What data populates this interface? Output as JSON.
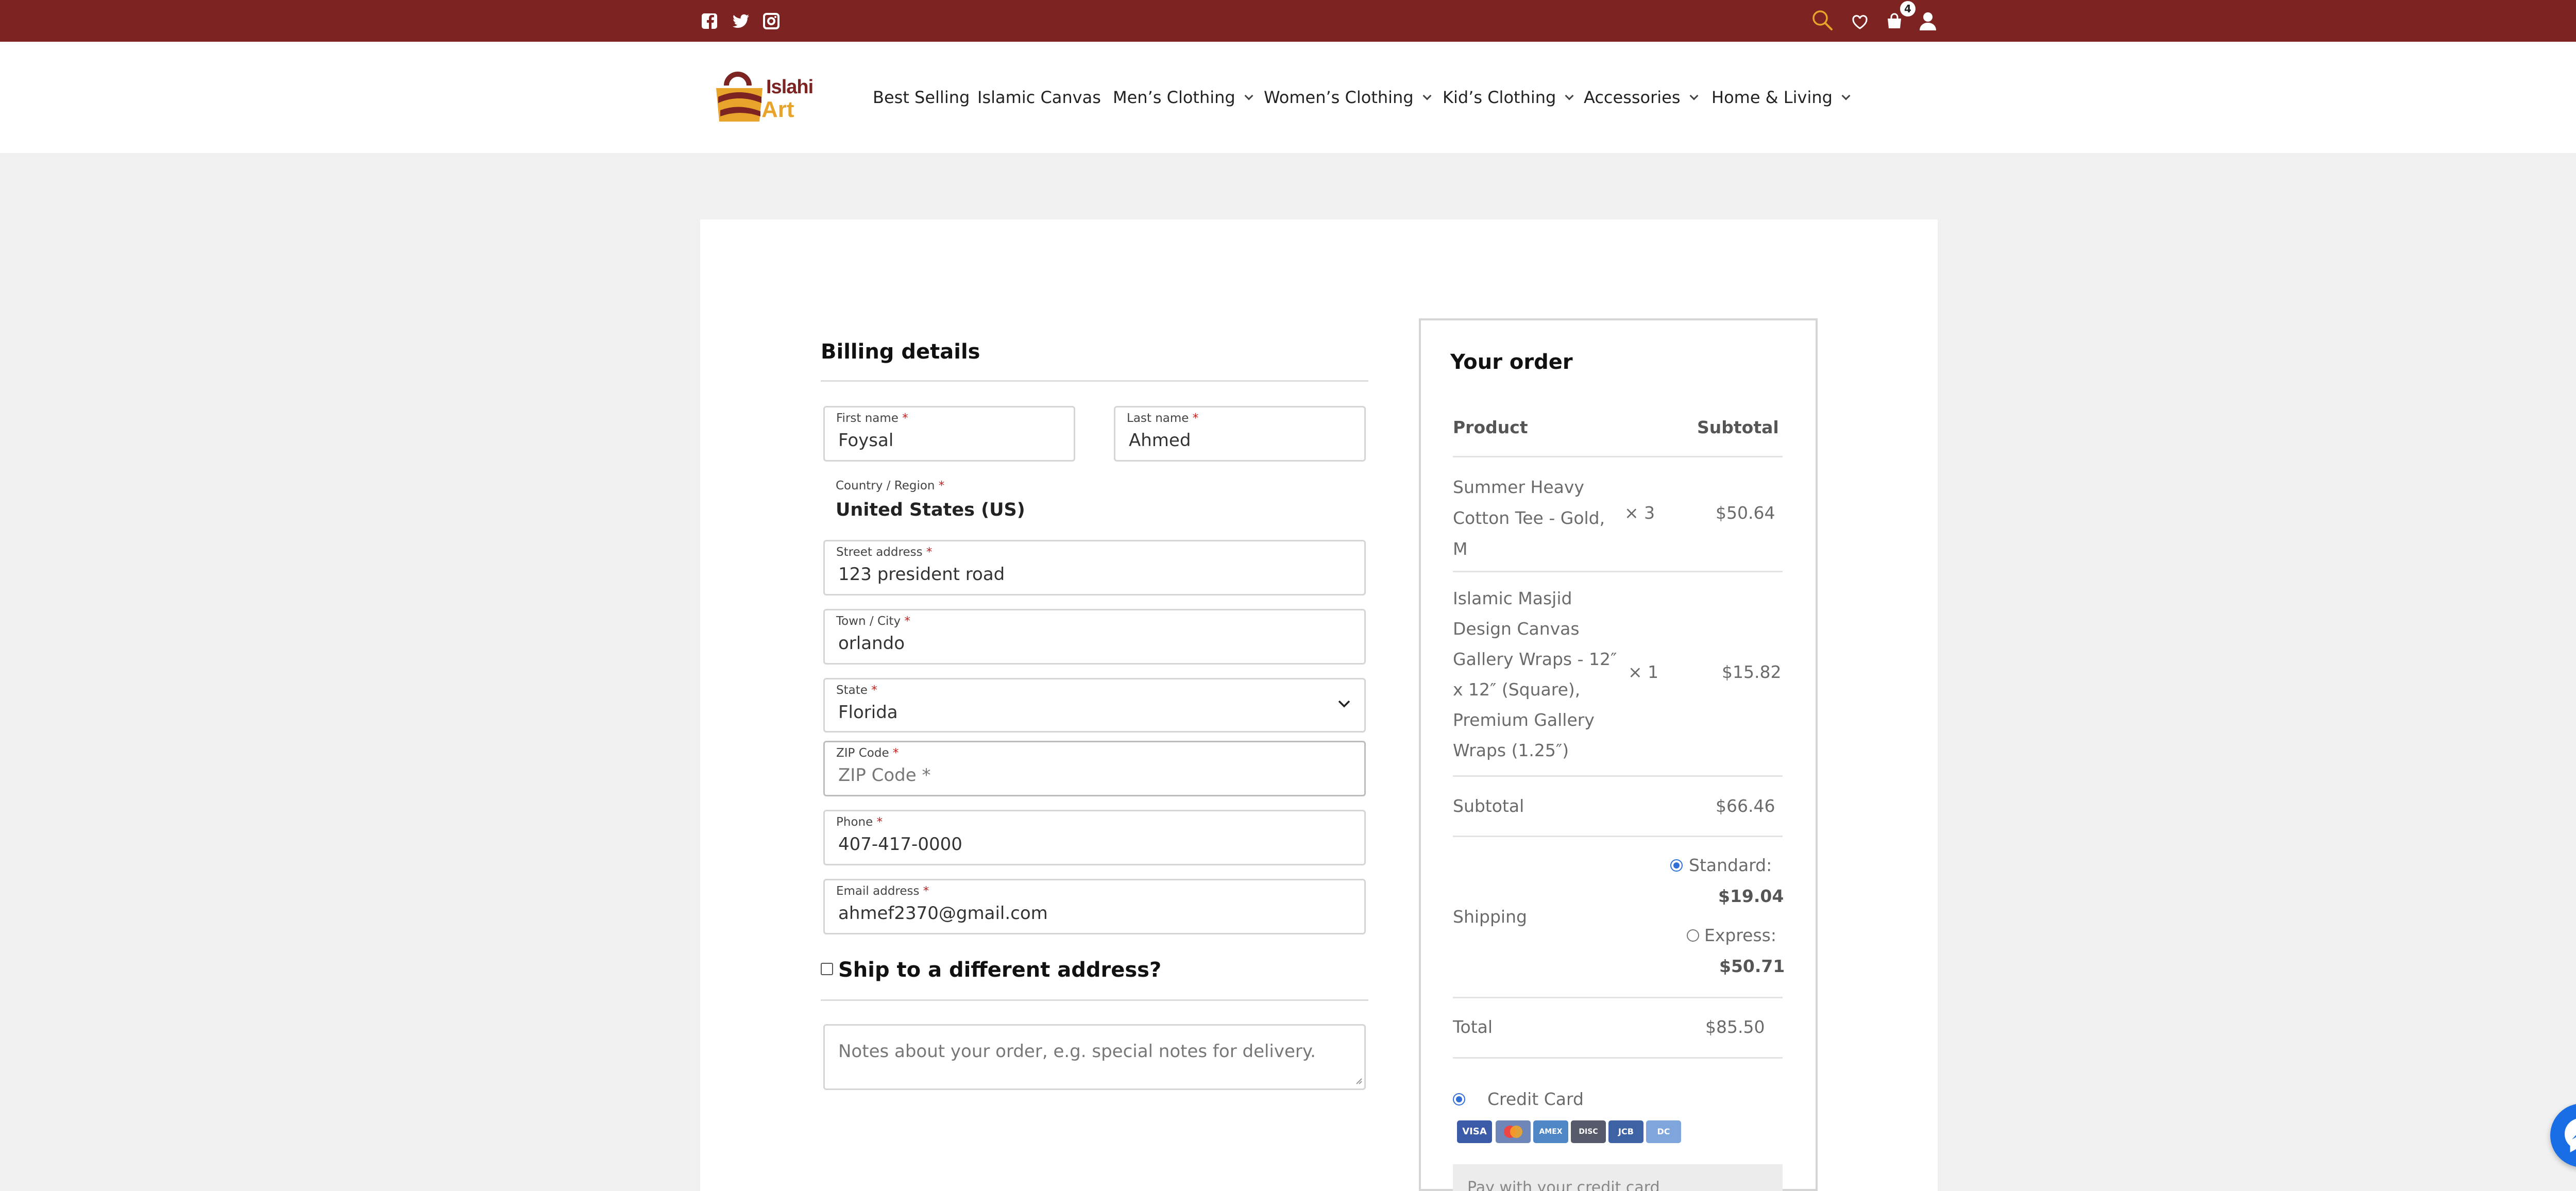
{
  "topbar": {
    "social": [
      "facebook-icon",
      "twitter-icon",
      "instagram-icon"
    ],
    "cart_count": "4"
  },
  "brand": {
    "line1": "Islahi",
    "line2": "Art"
  },
  "nav": [
    {
      "label": "Best Selling",
      "has_menu": false
    },
    {
      "label": "Islamic Canvas",
      "has_menu": false
    },
    {
      "label": "Men’s Clothing",
      "has_menu": true
    },
    {
      "label": "Women’s Clothing",
      "has_menu": true
    },
    {
      "label": "Kid’s Clothing",
      "has_menu": true
    },
    {
      "label": "Accessories",
      "has_menu": true
    },
    {
      "label": "Home & Living",
      "has_menu": true
    }
  ],
  "billing": {
    "title": "Billing details",
    "first_name": {
      "label": "First name",
      "value": "Foysal"
    },
    "last_name": {
      "label": "Last name",
      "value": "Ahmed"
    },
    "country": {
      "label": "Country / Region",
      "value": "United States (US)"
    },
    "street": {
      "label": "Street address",
      "value": "123 president road"
    },
    "city": {
      "label": "Town / City",
      "value": "orlando"
    },
    "state": {
      "label": "State",
      "value": "Florida"
    },
    "zip": {
      "label": "ZIP Code",
      "placeholder": "ZIP Code *",
      "value": ""
    },
    "phone": {
      "label": "Phone",
      "value": "407-417-0000"
    },
    "email": {
      "label": "Email address",
      "value": "ahmef2370@gmail.com"
    },
    "required_mark": "*",
    "ship_different": "Ship to a different address?",
    "notes_placeholder": "Notes about your order, e.g. special notes for delivery."
  },
  "order": {
    "title": "Your order",
    "col_product": "Product",
    "col_subtotal": "Subtotal",
    "items": [
      {
        "lines": [
          "Summer Heavy",
          "Cotton Tee - Gold,",
          "M"
        ],
        "qty": "× 3",
        "price": "$50.64"
      },
      {
        "lines": [
          "Islamic Masjid",
          "Design Canvas",
          "Gallery Wraps - 12″",
          "x 12″ (Square),",
          "Premium Gallery",
          "Wraps (1.25″)"
        ],
        "qty": "× 1",
        "price": "$15.82"
      }
    ],
    "subtotal_label": "Subtotal",
    "subtotal_value": "$66.46",
    "shipping_label": "Shipping",
    "shipping_options": [
      {
        "label": "Standard:",
        "price": "$19.04",
        "selected": true
      },
      {
        "label": "Express:",
        "price": "$50.71",
        "selected": false
      }
    ],
    "total_label": "Total",
    "total_value": "$85.50",
    "payment_method": "Credit Card",
    "cards": [
      "VISA",
      "MC",
      "AMEX",
      "DISC",
      "JCB",
      "DC"
    ],
    "pay_box_text": "Pay with your credit card"
  },
  "colors": {
    "brand_red": "#7d2422",
    "accent_gold": "#e8a32a",
    "radio_blue": "#2f6fd6",
    "messenger_blue": "#1a6ee5"
  }
}
